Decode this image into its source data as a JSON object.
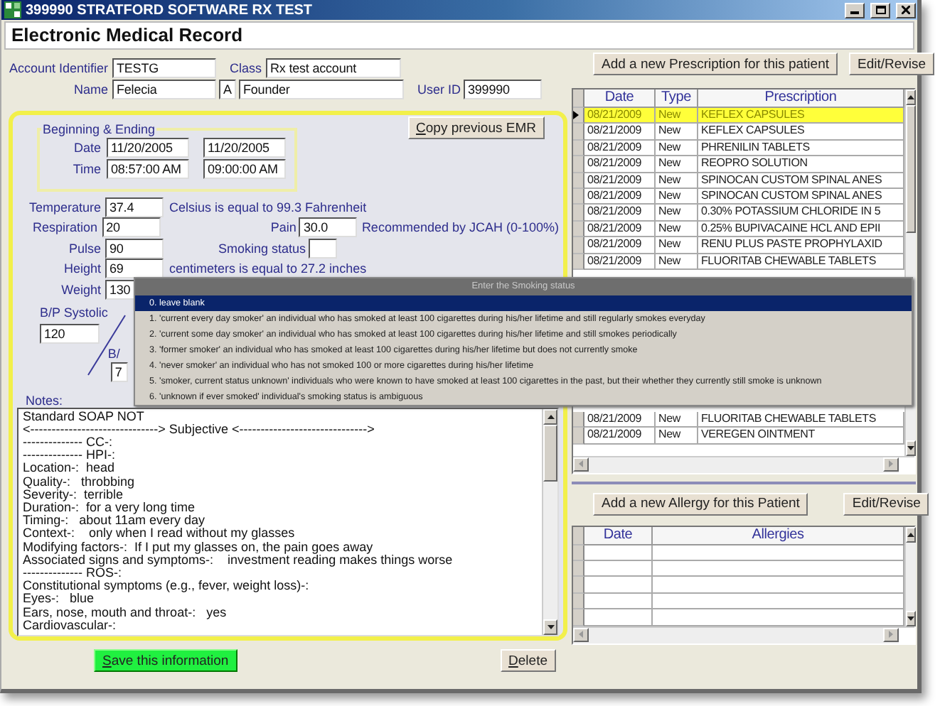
{
  "window": {
    "title": "399990 STRATFORD SOFTWARE RX TEST"
  },
  "header": {
    "title": "Electronic Medical Record"
  },
  "account": {
    "identifier": {
      "label": "Account Identifier",
      "value": "TESTG"
    },
    "class": {
      "label": "Class",
      "value": "Rx test account"
    },
    "name": {
      "label": "Name",
      "first": "Felecia",
      "middle": "A",
      "last": "Founder"
    },
    "user_id": {
      "label": "User ID",
      "value": "399990"
    }
  },
  "period": {
    "legend": "Beginning & Ending",
    "rows": [
      {
        "label": "Date",
        "start": "11/20/2005",
        "end": "11/20/2005"
      },
      {
        "label": "Time",
        "start": "08:57:00 AM",
        "end": "09:00:00 AM"
      }
    ]
  },
  "copy_button": "Copy previous EMR",
  "vitals": [
    {
      "label": "Temperature",
      "value": "37.4",
      "note": "Celsius is equal to 99.3 Fahrenheit"
    },
    {
      "label": "Respiration",
      "value": "20"
    },
    {
      "label": "Pulse",
      "value": "90"
    },
    {
      "label": "Height",
      "value": "69",
      "note": "centimeters is equal to 27.2 inches"
    },
    {
      "label": "Weight",
      "value": "130"
    }
  ],
  "pain": {
    "label": "Pain",
    "value": "30.0",
    "note": "Recommended by JCAH (0-100%)"
  },
  "smoking": {
    "label": "Smoking status"
  },
  "blood_pressure": {
    "systolic": {
      "label": "B/P Systolic",
      "value": "120"
    },
    "diastolic": {
      "label": "B/",
      "value": "7"
    }
  },
  "notes": {
    "label": "Notes:",
    "lines": [
      "Standard SOAP NOT",
      "<------------------------------> Subjective <------------------------------>",
      "-------------- CC-:",
      "-------------- HPI-:",
      "Location-:  head",
      "Quality-:   throbbing",
      "Severity-:  terrible",
      "Duration-:  for a very long time",
      "Timing-:   about 11am every day",
      "Context-:    only when I read without my glasses",
      "Modifying factors-:  If I put my glasses on, the pain goes away",
      "Associated signs and symptoms-:    investment reading makes things worse",
      "-------------- ROS-:",
      "Constitutional symptoms (e.g., fever, weight loss)-:",
      "Eyes-:   blue",
      "Ears, nose, mouth and throat-:   yes",
      "Cardiovascular-:"
    ]
  },
  "save_button": "Save this information",
  "delete_button": "Delete",
  "prescriptions": {
    "add_button": "Add a new Prescription for this patient",
    "edit_button": "Edit/Revise",
    "columns": [
      "Date",
      "Type",
      "Prescription"
    ],
    "rows": [
      {
        "date": "08/21/2009",
        "type": "New",
        "prescription": "KEFLEX CAPSULES",
        "selected": true
      },
      {
        "date": "08/21/2009",
        "type": "New",
        "prescription": "KEFLEX CAPSULES",
        "selected": false
      },
      {
        "date": "08/21/2009",
        "type": "New",
        "prescription": "PHRENILIN TABLETS",
        "selected": false
      },
      {
        "date": "08/21/2009",
        "type": "New",
        "prescription": "REOPRO SOLUTION",
        "selected": false
      },
      {
        "date": "08/21/2009",
        "type": "New",
        "prescription": "SPINOCAN CUSTOM SPINAL ANES",
        "selected": false
      },
      {
        "date": "08/21/2009",
        "type": "New",
        "prescription": "SPINOCAN CUSTOM SPINAL ANES",
        "selected": false
      },
      {
        "date": "08/21/2009",
        "type": "New",
        "prescription": "0.30% POTASSIUM CHLORIDE IN 5",
        "selected": false
      },
      {
        "date": "08/21/2009",
        "type": "New",
        "prescription": "0.25% BUPIVACAINE HCL AND EPII",
        "selected": false
      },
      {
        "date": "08/21/2009",
        "type": "New",
        "prescription": "RENU PLUS PASTE PROPHYLAXID",
        "selected": false
      },
      {
        "date": "08/21/2009",
        "type": "New",
        "prescription": "FLUORITAB CHEWABLE TABLETS",
        "selected": false
      }
    ],
    "rows_below_popup": [
      {
        "date": "08/21/2009",
        "type": "New",
        "prescription": "FLUORITAB CHEWABLE TABLETS",
        "selected": false
      },
      {
        "date": "08/21/2009",
        "type": "New",
        "prescription": "VEREGEN OINTMENT",
        "selected": false
      }
    ]
  },
  "allergies": {
    "add_button": "Add a new Allergy for this Patient",
    "edit_button": "Edit/Revise",
    "columns": [
      "Date",
      "Allergies"
    ]
  },
  "smoking_menu": {
    "title": "Enter the Smoking status",
    "options": [
      {
        "label": "0. leave blank",
        "selected": true
      },
      {
        "label": "1. 'current every day smoker' an individual who has smoked at least 100 cigarettes during his/her lifetime and still regularly smokes everyday",
        "selected": false
      },
      {
        "label": "2. 'current some day smoker' an individual who has smoked at least 100 cigarettes during his/her lifetime and still smokes periodically",
        "selected": false
      },
      {
        "label": "3. 'former smoker' an individual who has smoked at least 100 cigarettes during his/her lifetime but does not currently smoke",
        "selected": false
      },
      {
        "label": "4. 'never smoker' an individual who has not smoked 100 or more cigarettes during his/her lifetime",
        "selected": false
      },
      {
        "label": "5. 'smoker, current status unknown' individuals who were known to have smoked at least 100 cigarettes in the past, but their whether they currently still smoke is unknown",
        "selected": false
      },
      {
        "label": "6. 'unknown if ever smoked' individual's smoking status is ambiguous",
        "selected": false
      }
    ]
  }
}
